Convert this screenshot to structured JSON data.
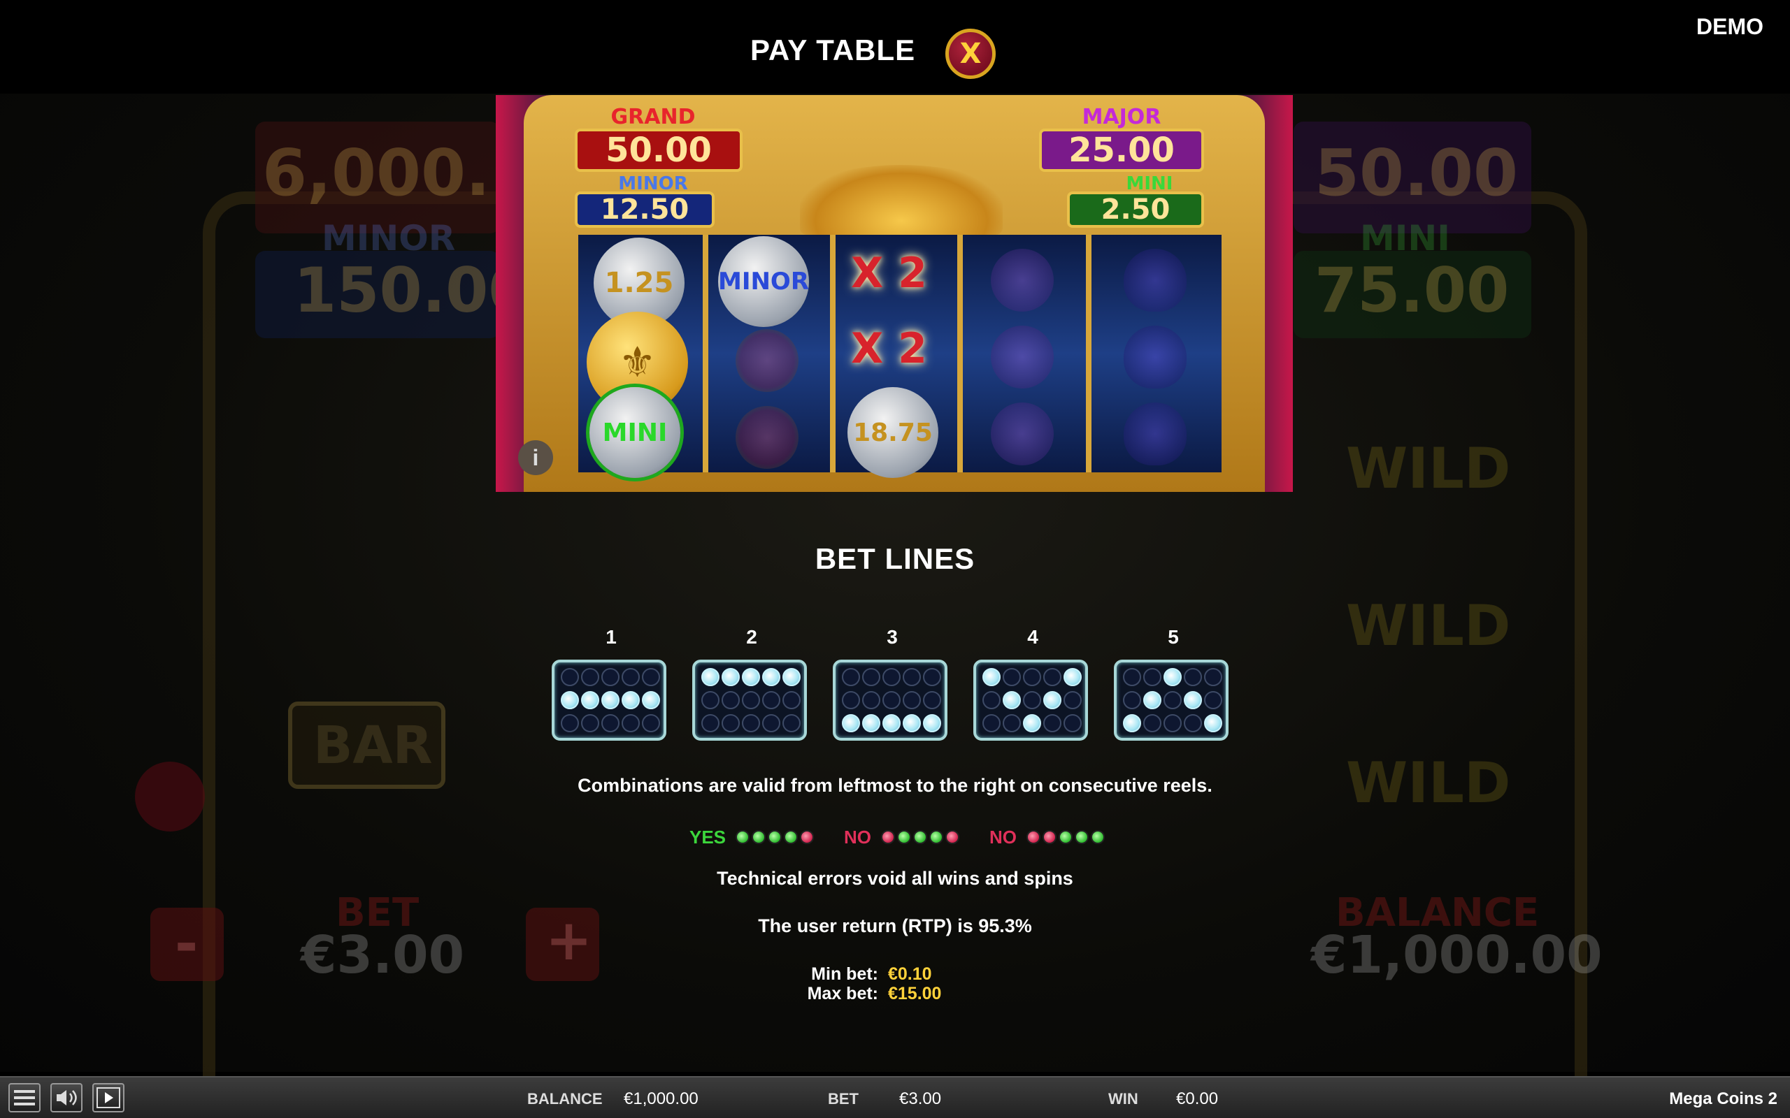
{
  "header": {
    "title": "PAY TABLE",
    "close_label": "X",
    "demo_label": "DEMO"
  },
  "preview": {
    "jackpots": {
      "grand": {
        "label": "GRAND",
        "value": "50.00"
      },
      "major": {
        "label": "MAJOR",
        "value": "25.00"
      },
      "minor": {
        "label": "MINOR",
        "value": "12.50"
      },
      "mini": {
        "label": "MINI",
        "value": "2.50"
      }
    },
    "symbols": {
      "coin_125": "1.25",
      "coin_minor": "MINOR",
      "coin_mini": "MINI",
      "coin_1875": "18.75",
      "multiplier": "X 2",
      "info": "i"
    }
  },
  "bet_lines": {
    "title": "BET LINES",
    "lines": [
      {
        "number": "1",
        "active_row": [
          1,
          1,
          1,
          1,
          1
        ]
      },
      {
        "number": "2",
        "active_row": [
          0,
          0,
          0,
          0,
          0
        ]
      },
      {
        "number": "3",
        "active_row": [
          2,
          2,
          2,
          2,
          2
        ]
      },
      {
        "number": "4",
        "active_row": [
          0,
          1,
          2,
          1,
          0
        ]
      },
      {
        "number": "5",
        "active_row": [
          2,
          1,
          0,
          1,
          2
        ]
      }
    ]
  },
  "rules": {
    "combinations": "Combinations are valid from leftmost to the right on consecutive reels.",
    "legend": [
      {
        "word": "YES",
        "color": "#3cd63c",
        "dots": [
          "g",
          "g",
          "g",
          "g",
          "r"
        ]
      },
      {
        "word": "NO",
        "color": "#e0305a",
        "dots": [
          "r",
          "g",
          "g",
          "g",
          "r"
        ]
      },
      {
        "word": "NO",
        "color": "#e0305a",
        "dots": [
          "r",
          "r",
          "g",
          "g",
          "g"
        ]
      }
    ],
    "technical_errors": "Technical errors void all wins and spins",
    "rtp": "The user return (RTP) is 95.3%",
    "min_bet_label": "Min bet:",
    "min_bet_value": "€0.10",
    "max_bet_label": "Max bet:",
    "max_bet_value": "€15.00"
  },
  "bottom_bar": {
    "balance_label": "BALANCE",
    "balance_value": "€1,000.00",
    "bet_label": "BET",
    "bet_value": "€3.00",
    "win_label": "WIN",
    "win_value": "€0.00",
    "game_name": "Mega Coins 2"
  },
  "background": {
    "grand_value": "6,000.",
    "major_value": "50.00",
    "minor_label": "MINOR",
    "minor_value": "150.00",
    "mini_label": "MINI",
    "mini_value": "75.00",
    "bet_label": "BET",
    "bet_value": "€3.00",
    "balance_label": "BALANCE",
    "balance_value": "€1,000.00",
    "bar_label": "BAR",
    "wild_label": "WILD",
    "minus": "-",
    "plus": "+"
  },
  "colors": {
    "accent_gold": "#ffd23a",
    "yes_green": "#3cd63c",
    "no_red": "#e0305a"
  }
}
